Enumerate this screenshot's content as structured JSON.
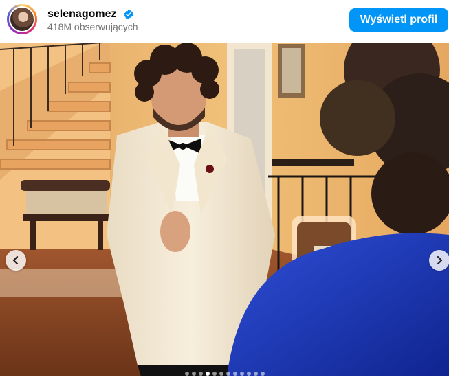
{
  "header": {
    "username": "selenagomez",
    "followers": "418M obserwujących",
    "profile_button": "Wyświetl profil",
    "verified_icon": "verified-badge-icon",
    "avatar_icon": "profile-avatar"
  },
  "carousel": {
    "prev_icon": "chevron-left-icon",
    "next_icon": "chevron-right-icon",
    "slide_count": 12,
    "active_slide": 4
  },
  "colors": {
    "accent": "#0095f6",
    "verified": "#0095f6",
    "secondary_text": "#737373"
  }
}
